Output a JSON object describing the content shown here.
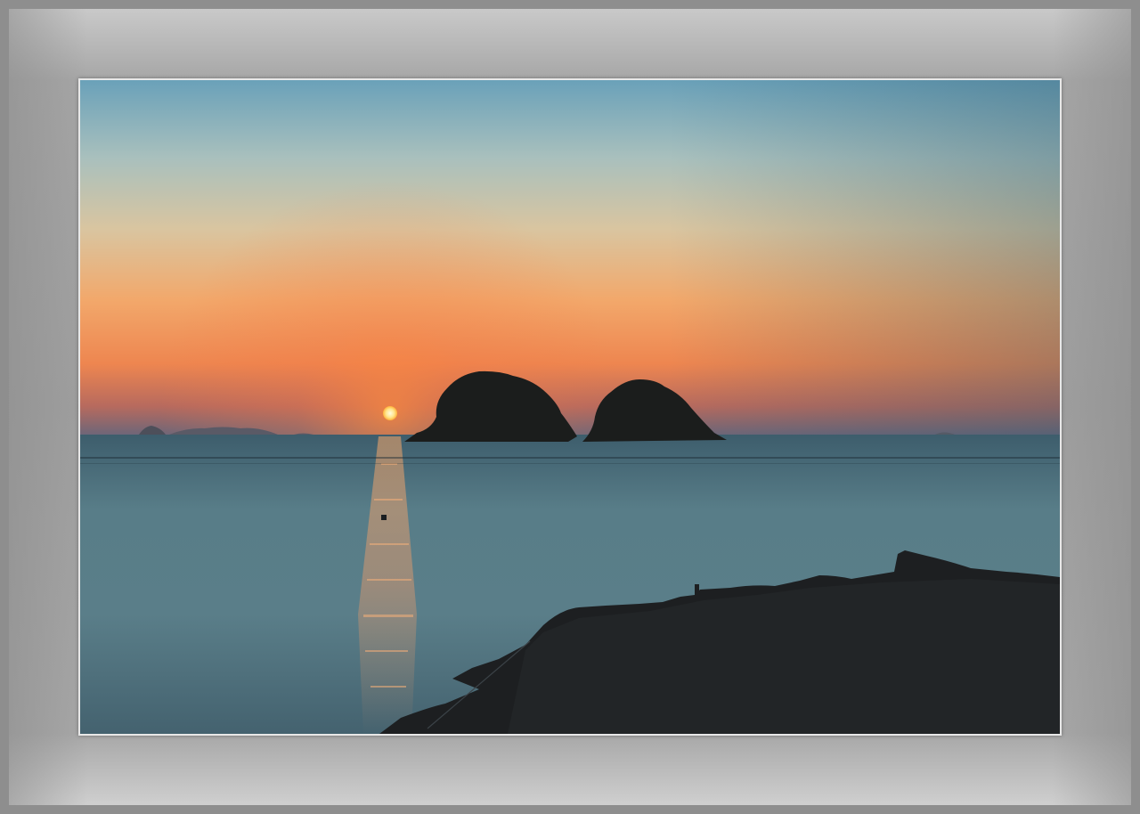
{
  "scene": {
    "subject": "sunset-over-sea-with-two-islands",
    "colors": {
      "sky_top": "#6fa2b8",
      "sky_mid": "#c9c3a8",
      "sky_warm": "#f0a468",
      "sky_horizon": "#e86a3c",
      "haze": "#7b6a78",
      "sea": "#4f6f7c",
      "sun": "#fff1b0",
      "silhouette": "#1c1f21",
      "frame": "#9c9c9c"
    }
  }
}
